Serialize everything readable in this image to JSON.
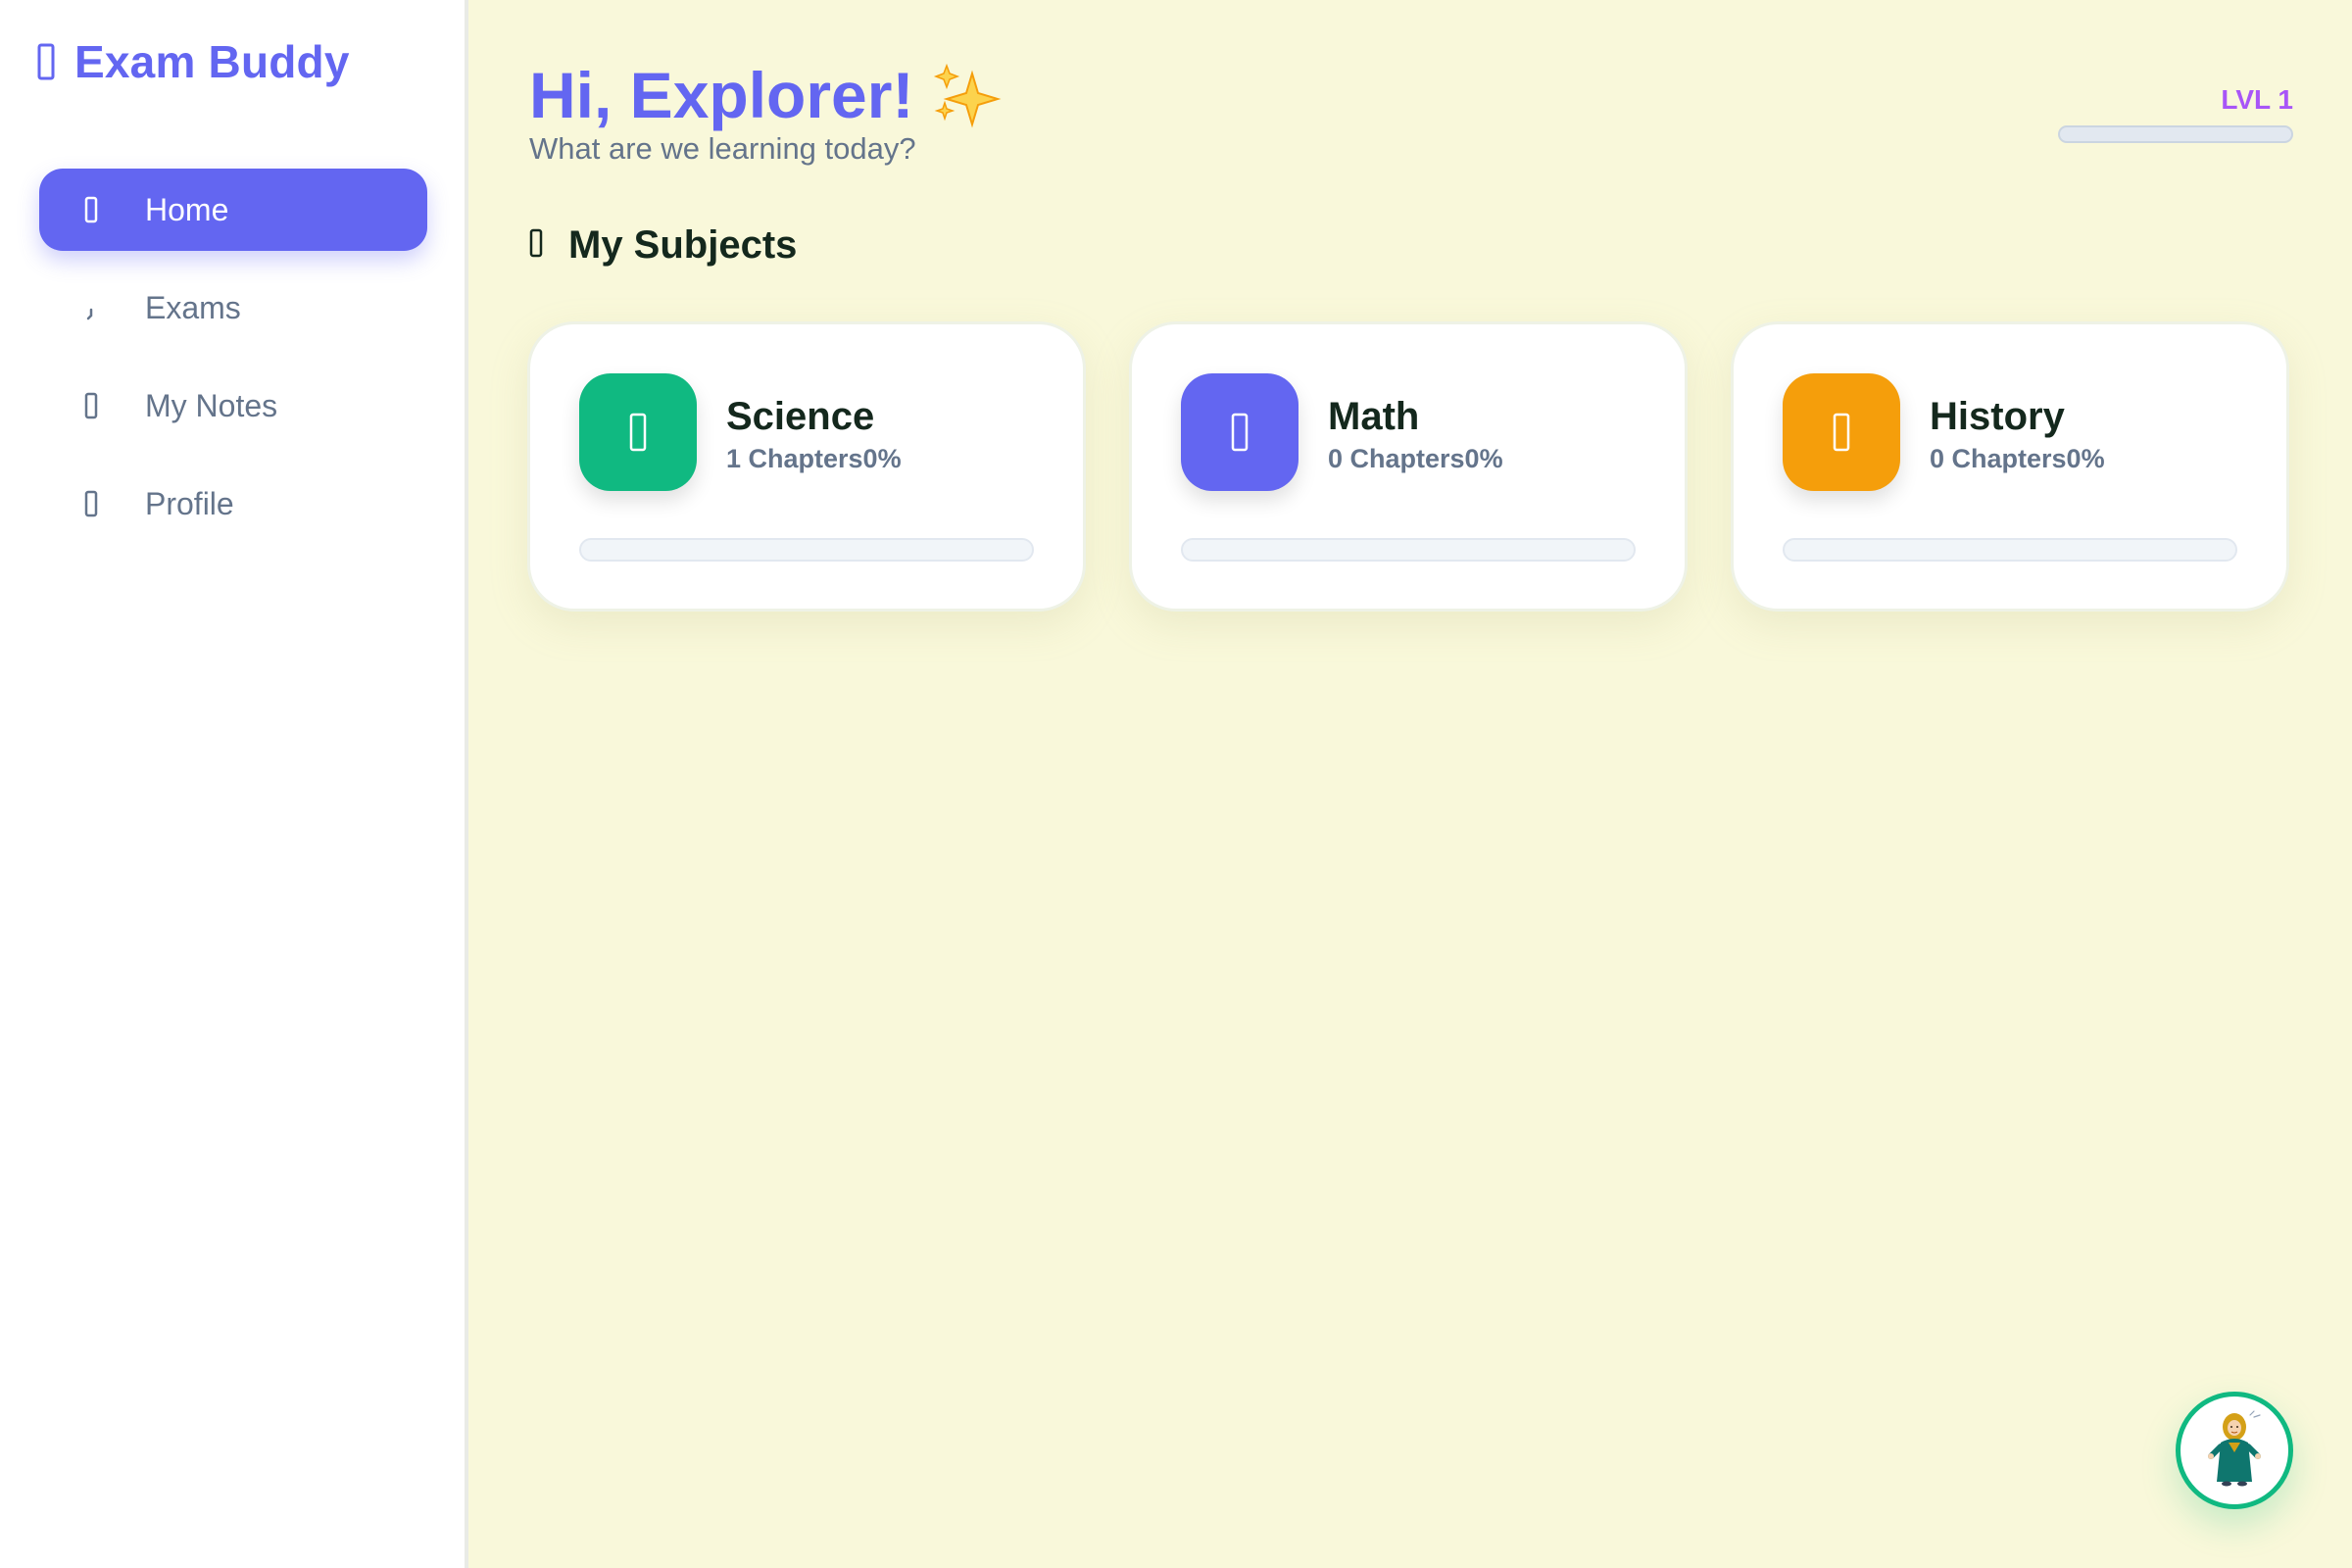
{
  "app": {
    "name": "Exam Buddy",
    "icon": "graduation-cap-icon",
    "accent": "#6366f1"
  },
  "sidebar": {
    "items": [
      {
        "label": "Home",
        "icon": "home-icon",
        "active": true
      },
      {
        "label": "Exams",
        "icon": "clipboard-icon",
        "active": false
      },
      {
        "label": "My Notes",
        "icon": "notebook-icon",
        "active": false
      },
      {
        "label": "Profile",
        "icon": "user-icon",
        "active": false
      }
    ]
  },
  "header": {
    "greeting": "Hi, Explorer!",
    "sparkle": "✨",
    "subtitle": "What are we learning today?",
    "level_label": "LVL 1",
    "level_progress": 0,
    "level_color": "#a855f7"
  },
  "subjects_section": {
    "title": "My Subjects",
    "icon": "books-icon",
    "subjects": [
      {
        "name": "Science",
        "meta": "1 Chapters0%",
        "icon": "flask-icon",
        "color": "#10b981",
        "progress": 0
      },
      {
        "name": "Math",
        "meta": "0 Chapters0%",
        "icon": "calculator-icon",
        "color": "#6366f1",
        "progress": 0
      },
      {
        "name": "History",
        "meta": "0 Chapters0%",
        "icon": "scroll-icon",
        "color": "#f59e0b",
        "progress": 0
      }
    ]
  },
  "mascot": {
    "icon": "mascot-avatar-icon",
    "ring_color": "#10b981"
  }
}
